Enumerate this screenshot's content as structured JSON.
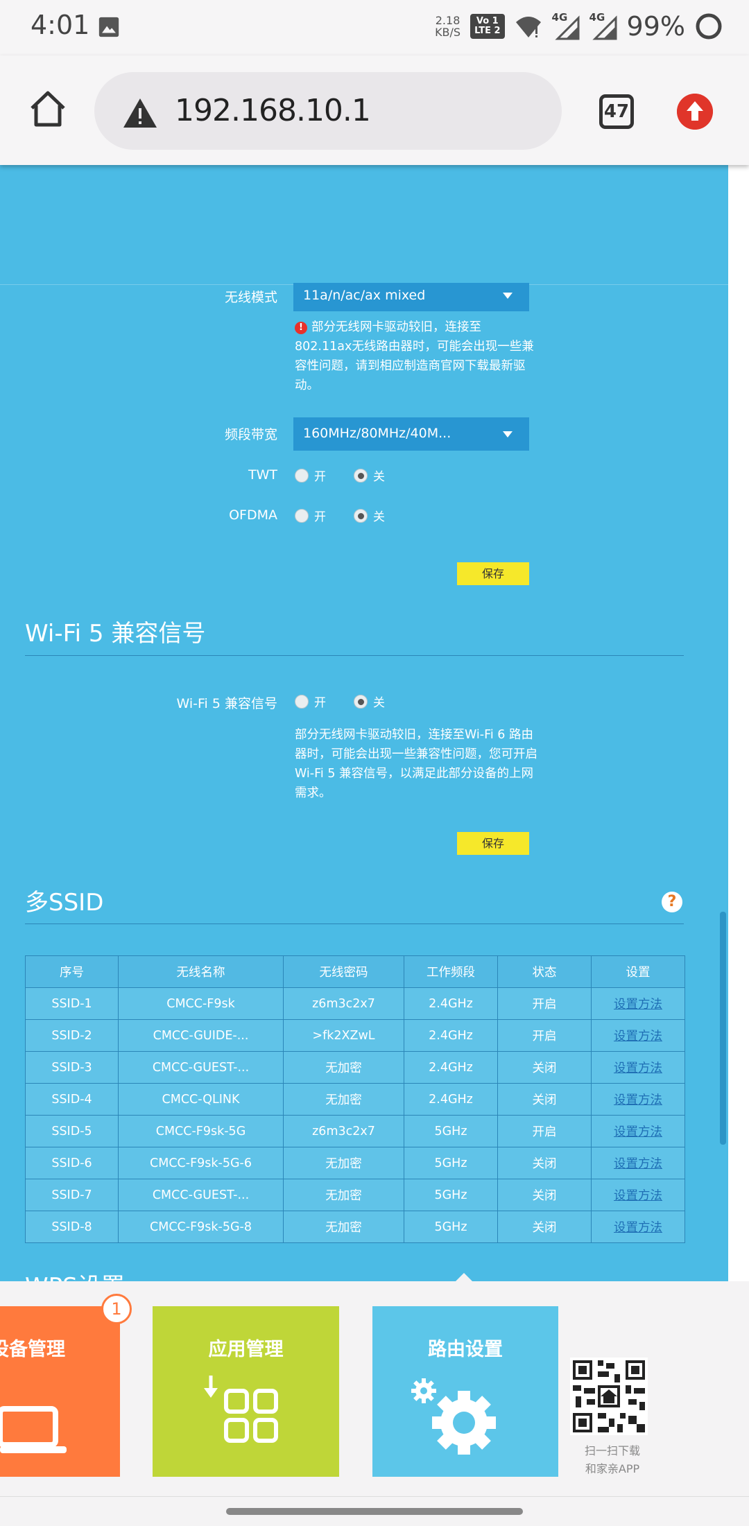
{
  "status_bar": {
    "time": "4:01",
    "net_speed_value": "2.18",
    "net_speed_unit": "KB/S",
    "volte_line1": "Vo 1",
    "volte_line2": "LTE 2",
    "signal1_label": "4G",
    "signal2_label": "4G",
    "battery": "99%"
  },
  "browser": {
    "url": "192.168.10.1",
    "tab_count": "47"
  },
  "wireless": {
    "mode_label": "无线模式",
    "mode_value": "11a/n/ac/ax mixed",
    "mode_warning": "部分无线网卡驱动较旧，连接至802.11ax无线路由器时，可能会出现一些兼容性问题，请到相应制造商官网下载最新驱动。",
    "bandwidth_label": "频段带宽",
    "bandwidth_value": "160MHz/80MHz/40M...",
    "twt_label": "TWT",
    "ofdma_label": "OFDMA",
    "on_label": "开",
    "off_label": "关",
    "twt_selected": "off",
    "ofdma_selected": "off",
    "save_label": "保存"
  },
  "wifi5": {
    "section_title": "Wi-Fi 5 兼容信号",
    "field_label": "Wi-Fi 5 兼容信号",
    "on_label": "开",
    "off_label": "关",
    "selected": "off",
    "description": "部分无线网卡驱动较旧，连接至Wi-Fi 6 路由器时，可能会出现一些兼容性问题，您可开启Wi-Fi 5 兼容信号，以满足此部分设备的上网需求。",
    "save_label": "保存"
  },
  "multi_ssid": {
    "section_title": "多SSID",
    "help_glyph": "?",
    "columns": [
      "序号",
      "无线名称",
      "无线密码",
      "工作频段",
      "状态",
      "设置"
    ],
    "rows": [
      [
        "SSID-1",
        "CMCC-F9sk",
        "z6m3c2x7",
        "2.4GHz",
        "开启",
        "设置方法"
      ],
      [
        "SSID-2",
        "CMCC-GUIDE-...",
        ">fk2XZwL",
        "2.4GHz",
        "开启",
        "设置方法"
      ],
      [
        "SSID-3",
        "CMCC-GUEST-...",
        "无加密",
        "2.4GHz",
        "关闭",
        "设置方法"
      ],
      [
        "SSID-4",
        "CMCC-QLINK",
        "无加密",
        "2.4GHz",
        "关闭",
        "设置方法"
      ],
      [
        "SSID-5",
        "CMCC-F9sk-5G",
        "z6m3c2x7",
        "5GHz",
        "开启",
        "设置方法"
      ],
      [
        "SSID-6",
        "CMCC-F9sk-5G-6",
        "无加密",
        "5GHz",
        "关闭",
        "设置方法"
      ],
      [
        "SSID-7",
        "CMCC-GUEST-...",
        "无加密",
        "5GHz",
        "关闭",
        "设置方法"
      ],
      [
        "SSID-8",
        "CMCC-F9sk-5G-8",
        "无加密",
        "5GHz",
        "关闭",
        "设置方法"
      ]
    ]
  },
  "wps": {
    "section_title_partial": "WPS设置"
  },
  "bottom_panel": {
    "device_tile": "设备管理",
    "device_badge": "1",
    "apps_tile": "应用管理",
    "router_tile": "路由设置",
    "qr_caption_line1": "扫一扫下载",
    "qr_caption_line2": "和家亲APP"
  }
}
